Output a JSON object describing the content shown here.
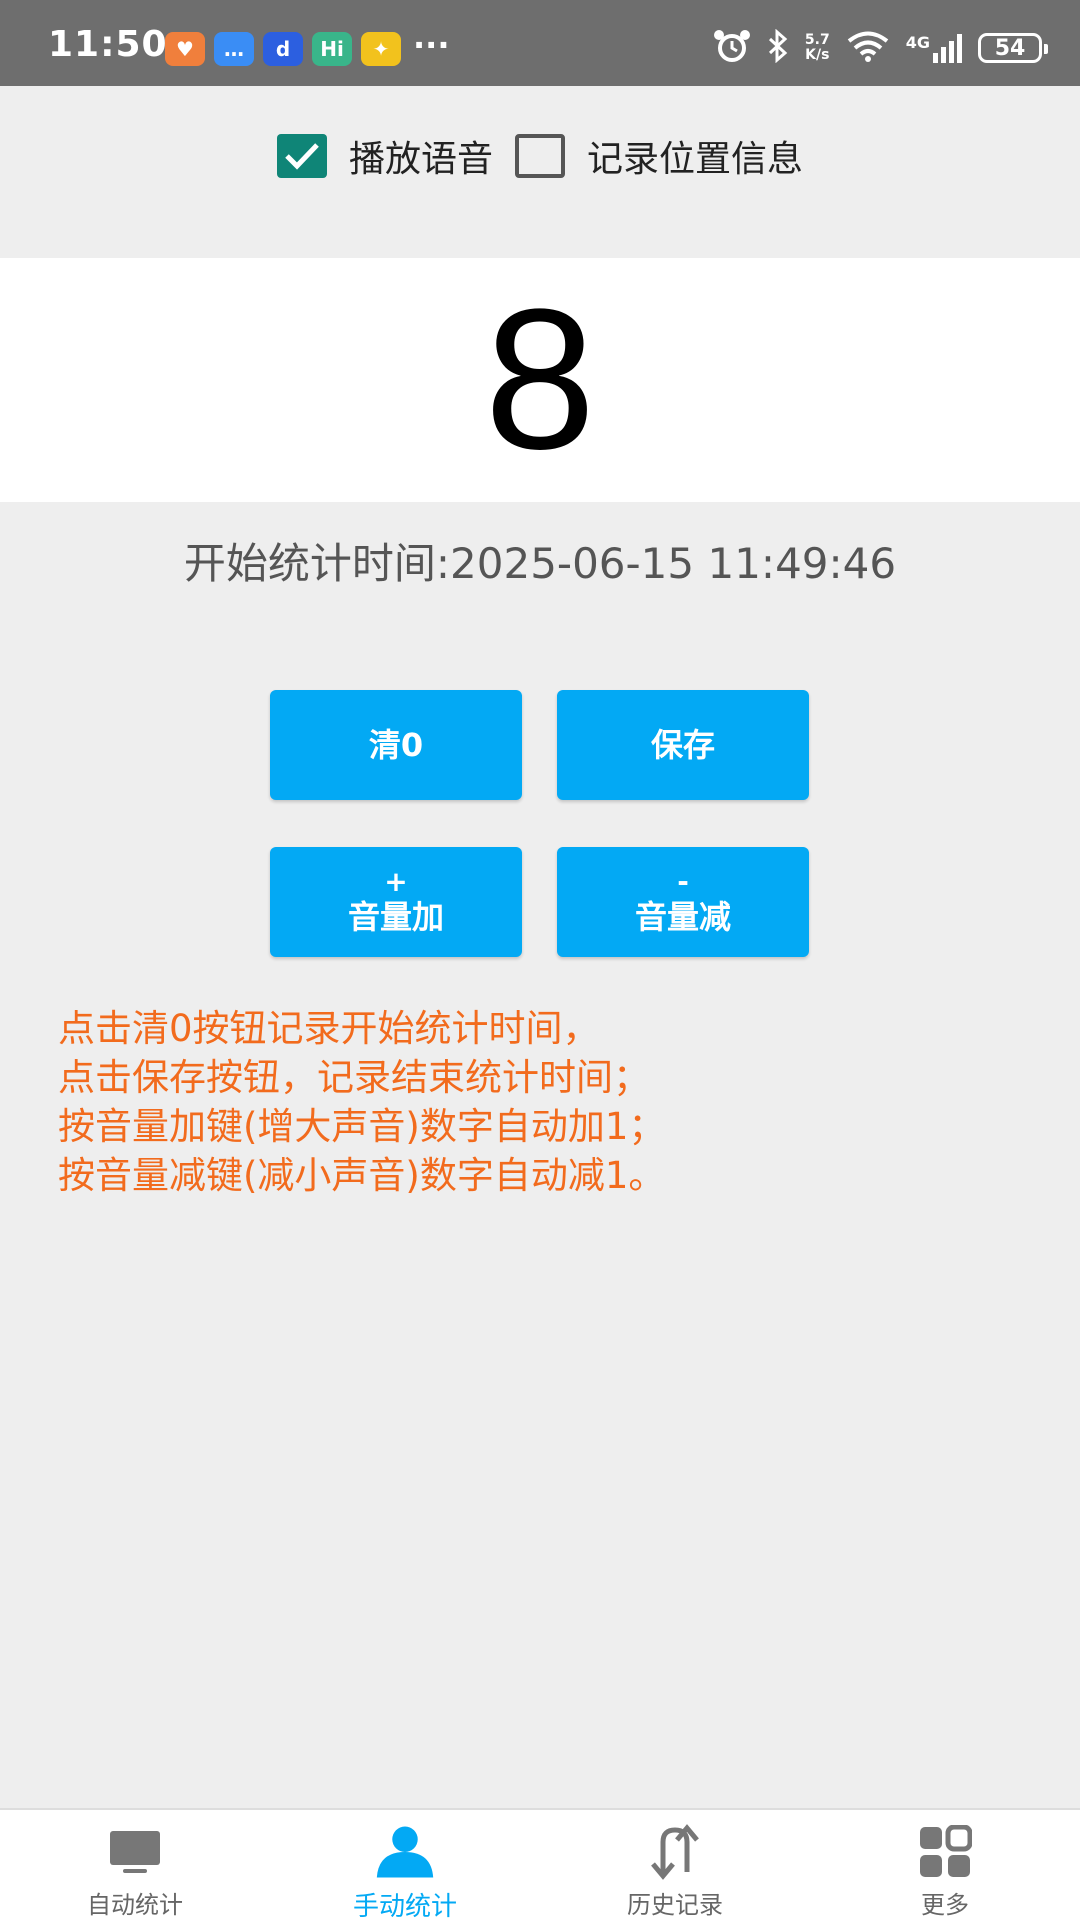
{
  "status_bar": {
    "time": "11:50",
    "notification_apps": [
      {
        "icon": "heart-app-icon",
        "glyph": "♥",
        "color": "#f07f3c"
      },
      {
        "icon": "chat-app-icon",
        "glyph": "…",
        "color": "#3a8df5"
      },
      {
        "icon": "d-app-icon",
        "glyph": "d",
        "color": "#2c5fe0"
      },
      {
        "icon": "hi-app-icon",
        "glyph": "Hi",
        "color": "#39b58a"
      },
      {
        "icon": "bunny-app-icon",
        "glyph": "✦",
        "color": "#f2c21d"
      }
    ],
    "more": "···",
    "net_speed_value": "5.7",
    "net_speed_unit": "K/s",
    "network_type": "4G",
    "battery_level": "54"
  },
  "options": {
    "play_voice": {
      "label": "播放语音",
      "checked": true
    },
    "record_location": {
      "label": "记录位置信息",
      "checked": false
    }
  },
  "counter": {
    "value": "8"
  },
  "start_time": "开始统计时间:2025-06-15 11:49:46",
  "buttons": {
    "clear": {
      "label": "清0"
    },
    "save": {
      "label": "保存"
    },
    "volume_up": {
      "symbol": "+",
      "label": "音量加"
    },
    "volume_down": {
      "symbol": "-",
      "label": "音量减"
    }
  },
  "instructions": [
    "点击清0按钮记录开始统计时间，",
    "点击保存按钮，记录结束统计时间；",
    "按音量加键(增大声音)数字自动加1；",
    "按音量减键(减小声音)数字自动减1。"
  ],
  "nav": {
    "active_color": "#03a9f4",
    "inactive_color": "#666666",
    "items": [
      {
        "label": "自动统计",
        "icon": "monitor-icon",
        "active": false
      },
      {
        "label": "手动统计",
        "icon": "person-icon",
        "active": true
      },
      {
        "label": "历史记录",
        "icon": "swap-arrows-icon",
        "active": false
      },
      {
        "label": "更多",
        "icon": "grid-icon",
        "active": false
      }
    ]
  },
  "colors": {
    "button": "#03a9f4",
    "checkbox_checked": "#0f8577",
    "instruction_text": "#f26b1d",
    "status_bar": "#6e6e6e"
  }
}
